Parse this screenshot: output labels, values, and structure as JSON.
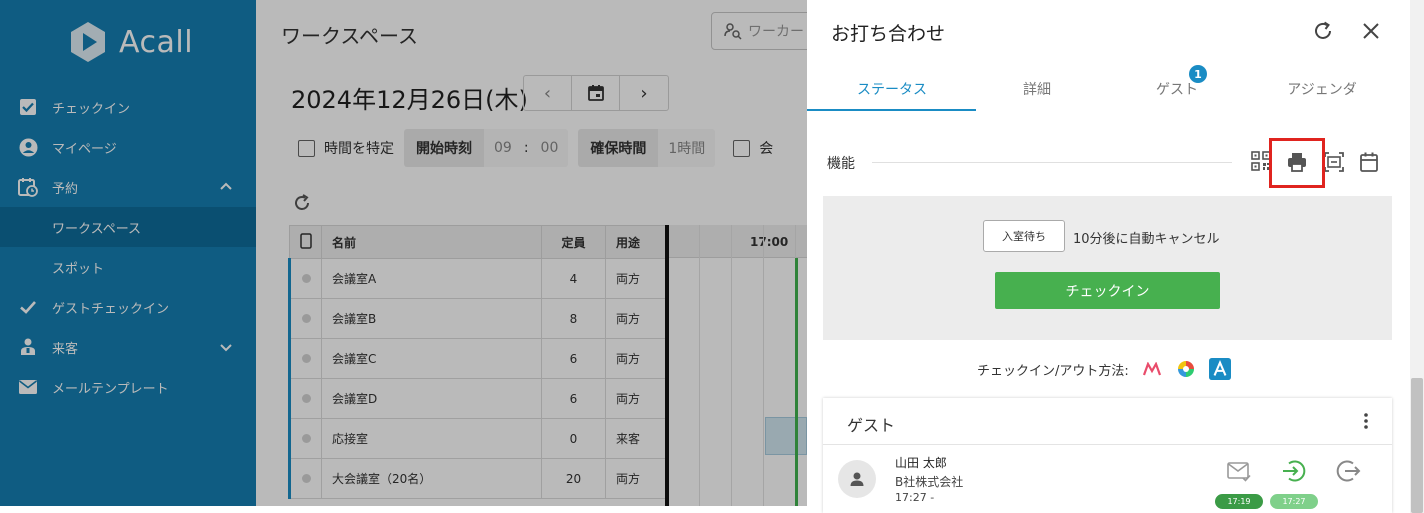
{
  "sidebar": {
    "logo": "Acall",
    "items": [
      {
        "label": "チェックイン"
      },
      {
        "label": "マイページ"
      },
      {
        "label": "予約"
      },
      {
        "label": "ワークスペース"
      },
      {
        "label": "スポット"
      },
      {
        "label": "ゲストチェックイン"
      },
      {
        "label": "来客"
      },
      {
        "label": "メールテンプレート"
      }
    ]
  },
  "main": {
    "title": "ワークスペース",
    "search_placeholder": "ワーカー",
    "date": "2024年12月26日(木)",
    "time_specify_label": "時間を特定",
    "start_time_label": "開始時刻",
    "start_hour": "09",
    "colon": ":",
    "start_min": "00",
    "duration_label": "確保時間",
    "duration_value": "1時間",
    "extra_checkbox_label": "会",
    "table": {
      "headers": [
        "名前",
        "定員",
        "用途"
      ],
      "time_header": "17:00",
      "rows": [
        {
          "name": "会議室A",
          "capacity": "4",
          "use": "両方"
        },
        {
          "name": "会議室B",
          "capacity": "8",
          "use": "両方"
        },
        {
          "name": "会議室C",
          "capacity": "6",
          "use": "両方"
        },
        {
          "name": "会議室D",
          "capacity": "6",
          "use": "両方"
        },
        {
          "name": "応接室",
          "capacity": "0",
          "use": "来客"
        },
        {
          "name": "大会議室（20名）",
          "capacity": "20",
          "use": "両方"
        }
      ]
    }
  },
  "panel": {
    "title": "お打ち合わせ",
    "tabs": [
      {
        "label": "ステータス"
      },
      {
        "label": "詳細"
      },
      {
        "label": "ゲスト"
      },
      {
        "label": "アジェンダ"
      }
    ],
    "guest_badge": "1",
    "function_label": "機能",
    "status": {
      "wait_badge": "入室待ち",
      "auto_cancel_text": "10分後に自動キャンセル",
      "checkin_button": "チェックイン"
    },
    "method_label": "チェックイン/アウト方法:",
    "guest_section": {
      "title": "ゲスト",
      "guest": {
        "name": "山田 太郎",
        "company": "B社株式会社",
        "time": "17:27  -",
        "mail_time": "17:19",
        "checkin_time": "17:27"
      }
    }
  },
  "colors": {
    "sidebar": "#157fb2",
    "accent": "#1a8cc4",
    "checkin_green": "#47b04f",
    "highlight_red": "#e0241f"
  }
}
